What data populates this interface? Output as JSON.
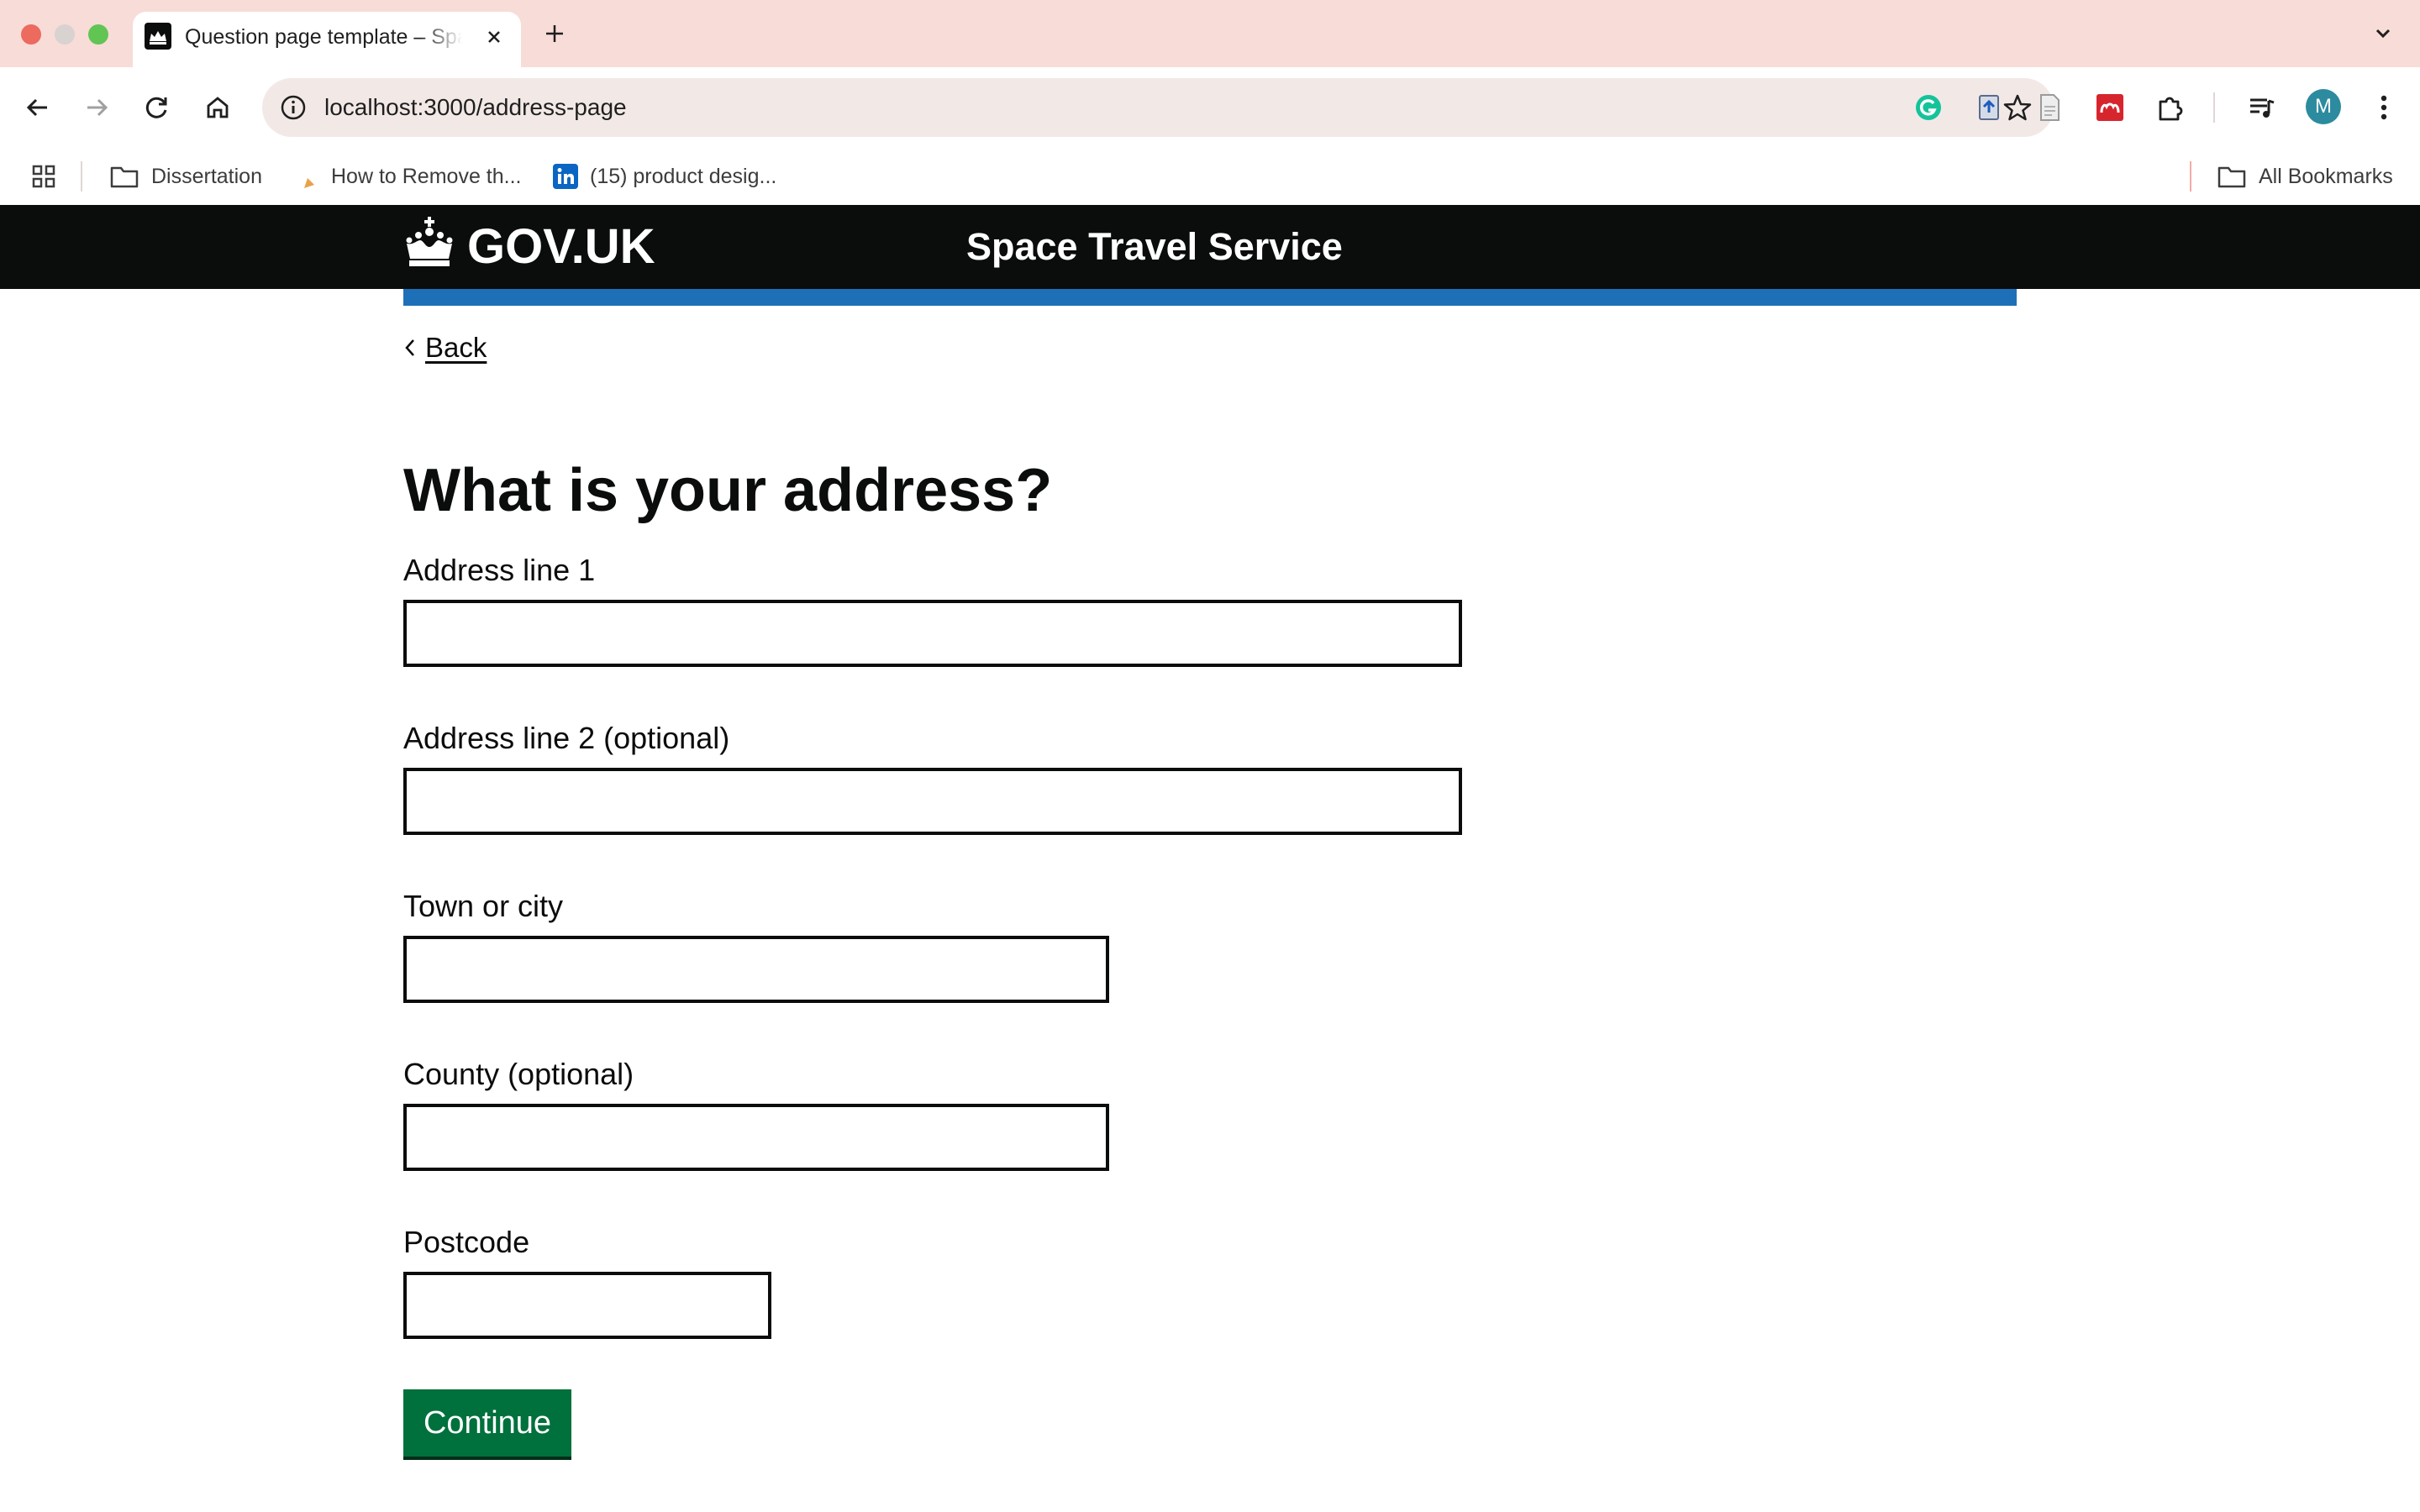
{
  "browser": {
    "tab_title": "Question page template – Space Travel Service",
    "url": "localhost:3000/address-page",
    "profile_initial": "M",
    "bookmarks": [
      {
        "label": "Dissertation",
        "icon": "folder-icon"
      },
      {
        "label": "How to Remove th...",
        "icon": "bookmark-favicon-icon"
      },
      {
        "label": "(15) product desig...",
        "icon": "linkedin-icon"
      }
    ],
    "all_bookmarks_label": "All Bookmarks"
  },
  "header": {
    "logotype": "GOV.UK",
    "service_name": "Space Travel Service",
    "accent_color": "#1d70b8"
  },
  "page": {
    "back_label": "Back",
    "title": "What is your address?",
    "fields": [
      {
        "label": "Address line 1",
        "value": ""
      },
      {
        "label": "Address line 2 (optional)",
        "value": ""
      },
      {
        "label": "Town or city",
        "value": ""
      },
      {
        "label": "County (optional)",
        "value": ""
      },
      {
        "label": "Postcode",
        "value": ""
      }
    ],
    "continue_label": "Continue",
    "button_color": "#00703c"
  }
}
